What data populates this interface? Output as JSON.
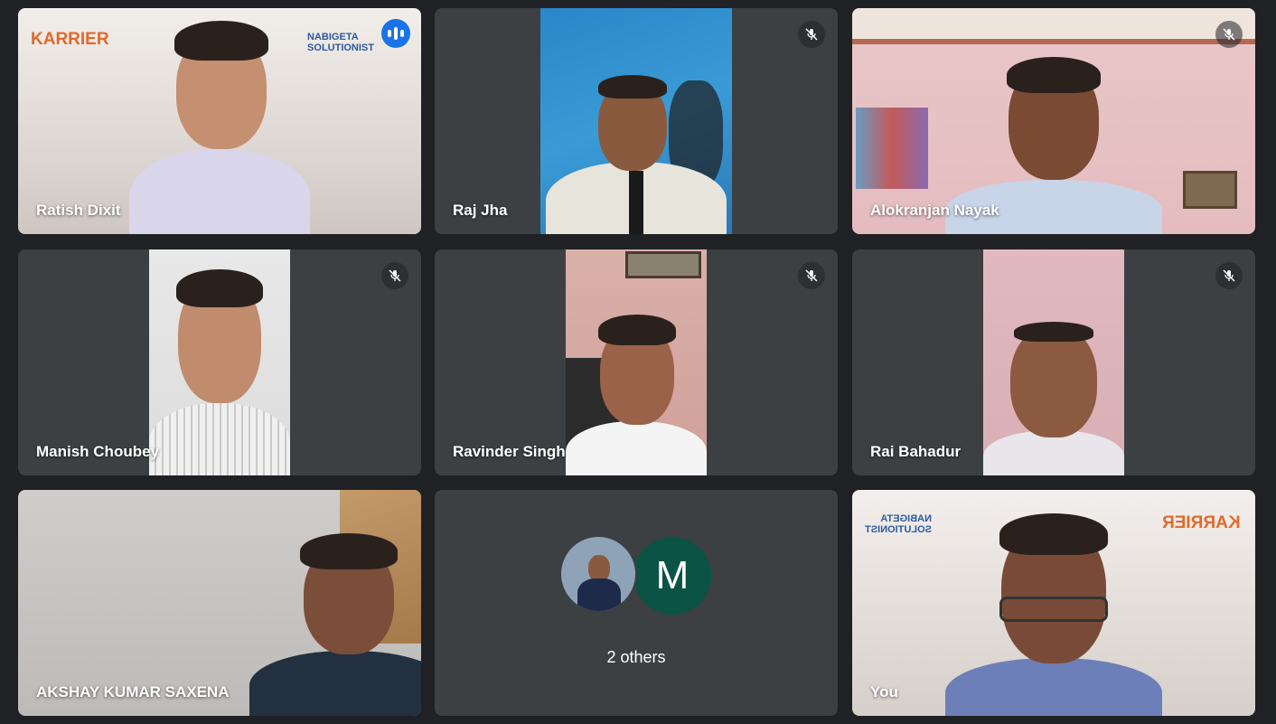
{
  "participants": [
    {
      "name": "Ratish Dixit",
      "speaking": true
    },
    {
      "name": "Raj Jha",
      "muted": true
    },
    {
      "name": "Alokranjan Nayak",
      "muted": true
    },
    {
      "name": "Manish Choubey",
      "muted": true
    },
    {
      "name": "Ravinder Singh",
      "muted": true
    },
    {
      "name": "Rai Bahadur",
      "muted": true
    },
    {
      "name": "AKSHAY KUMAR SAXENA"
    },
    {
      "name": "You"
    }
  ],
  "others": {
    "label": "2 others",
    "avatar_letter": "M",
    "avatar_letter_color": "#0b5345"
  },
  "logos": {
    "karrier": "KARRIER",
    "nabigeta_line1": "NABIGETA",
    "nabigeta_line2": "SOLUTIONIST"
  },
  "icons": {
    "muted": "mic-off-icon",
    "speaking": "audio-level-icon"
  },
  "colors": {
    "tile_bg": "#3c4043",
    "page_bg": "#202124",
    "speaking_border": "#8ab4f8",
    "speaking_badge": "#1a73e8"
  }
}
